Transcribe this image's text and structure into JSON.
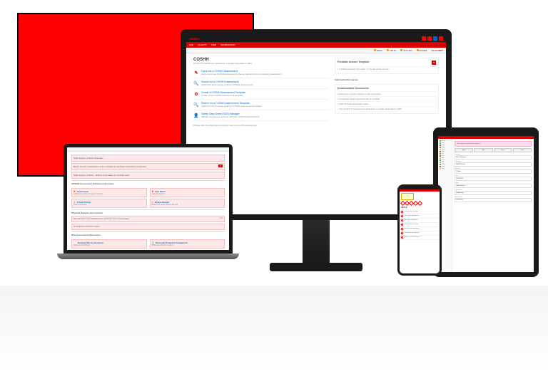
{
  "monitor": {
    "brand": "RISKEX",
    "menu": [
      "HSE",
      "QUALITY",
      "FIRE",
      "INFORMATION"
    ],
    "stats": [
      {
        "icon": "orange",
        "label": "19041"
      },
      {
        "icon": "orange",
        "label": "798.15"
      },
      {
        "icon": "orange",
        "label": "3273.284"
      },
      {
        "icon": "orange",
        "label": "£20,824"
      }
    ],
    "netbrand": "AssessNET",
    "page_title": "COSHH",
    "page_sub": "Control of Substances Hazardous to Health Regulations 2002",
    "actions": [
      {
        "icon": "✎",
        "title": "Carry out a COSHH Assessment",
        "desc": "Carry out a new COSHH assessment, choose manual entry or inventory assessment"
      },
      {
        "icon": "🔍",
        "title": "Search for a COSHH Assessment",
        "desc": "Search for and manage existing COSHH assessments"
      },
      {
        "icon": "⚙",
        "title": "Create a COSHH Assessment Template",
        "desc": "Create a new COSHH assessment template"
      },
      {
        "icon": "🔍",
        "title": "Search for a COSHH Assessment Template",
        "desc": "Search for and manage existing COSHH assessment templates"
      },
      {
        "icon": "👤",
        "title": "Safety Data Sheet (SDS) Manager",
        "desc": "Manage substances and use with your COSHH assessments"
      }
    ],
    "footnote": "Please note the following points when carrying out this assessment",
    "right_panels": [
      {
        "title": "Printable Answer Template",
        "rows": [
          "A COSHH Answer Template in rich document format"
        ],
        "plus": true
      },
      {
        "title": "Downloadable Documents",
        "rows": [
          "Examples of good practice in risk prevention",
          "Frequently asked questions about COSHH",
          "HSE COSHH Essentials Guide",
          "The Control of Substances Hazardous to Health Regulations 2002"
        ]
      }
    ],
    "info_heading": "Information Resources"
  },
  "laptop": {
    "banners": [
      {
        "text": "Safe System of Work Overview",
        "n": ""
      },
      {
        "text": "Below shows a breakdown of the substances and their Hazardous properties",
        "n": "2"
      },
      {
        "text": "Safe System of Work - actions to be taken or controls used",
        "n": ""
      }
    ],
    "sect1": "COSHH Assessment Substance Overview",
    "cards": [
      {
        "icon": "⚑",
        "title": "Anti Freeze",
        "desc": "Antifreeze solution for engine cooling"
      },
      {
        "icon": "⚑",
        "title": "Gun Wash",
        "desc": "Cleaning solvent"
      },
      {
        "icon": "⚠",
        "title": "2 Pack Primer",
        "desc": "Primer basecoat"
      },
      {
        "icon": "⚠",
        "title": "Brake Cleaner",
        "desc": "Brake and clutch cleaner aerosol"
      }
    ],
    "sect2": "Physical Hazards and Controls",
    "rows": [
      {
        "text": "Has information about hazards of the substances been communicated",
        "n": "Yes"
      },
      {
        "text": "No hazardous emissions created",
        "n": ""
      }
    ],
    "sect3": "Risk Assessment Resources",
    "cards2": [
      {
        "icon": "📄",
        "title": "General Site Assessment",
        "desc": "Initial overall findings"
      },
      {
        "icon": "📋",
        "title": "Personal Protective Equipment",
        "desc": "PPE requirements resulting"
      }
    ]
  },
  "tablet": {
    "side_items": [
      {
        "c": "g",
        "t": "Active"
      },
      {
        "c": "g",
        "t": "Live"
      },
      {
        "c": "r",
        "t": "Open"
      },
      {
        "c": "g",
        "t": "Done"
      },
      {
        "c": "y",
        "t": "Pend"
      },
      {
        "c": "r",
        "t": "Risk"
      },
      {
        "c": "g",
        "t": "OK"
      },
      {
        "c": "r",
        "t": "Fail"
      },
      {
        "c": "y",
        "t": "Rev"
      },
      {
        "c": "g",
        "t": "Pass"
      },
      {
        "c": "gr",
        "t": "N/A"
      },
      {
        "c": "g",
        "t": "Comp"
      },
      {
        "c": "r",
        "t": "High"
      },
      {
        "c": "y",
        "t": "Med"
      }
    ],
    "pink_banner": "Task requires review before approval",
    "buttons": [
      "Back",
      "Edit",
      "Save",
      "Print"
    ],
    "fields": [
      {
        "l": "Location",
        "v": "Main Workshop"
      },
      {
        "l": "Reference",
        "v": "RA-2023-0112"
      },
      {
        "l": "Assessor",
        "v": "J Smith"
      },
      {
        "l": "Date",
        "v": "12/03/2024"
      },
      {
        "l": "Status",
        "v": "Under Review"
      },
      {
        "l": "Department",
        "v": "Engineering"
      },
      {
        "l": "Review Due",
        "v": "12/03/2025"
      }
    ]
  },
  "phone": {
    "title": "H315-2",
    "hazards": 5,
    "items": [
      "Causes skin irritation",
      "May cause drowsiness",
      "Harmful if swallowed",
      "Keep away from heat",
      "Avoid breathing vapour",
      "Wear protective gloves",
      "Store in ventilated area"
    ]
  }
}
